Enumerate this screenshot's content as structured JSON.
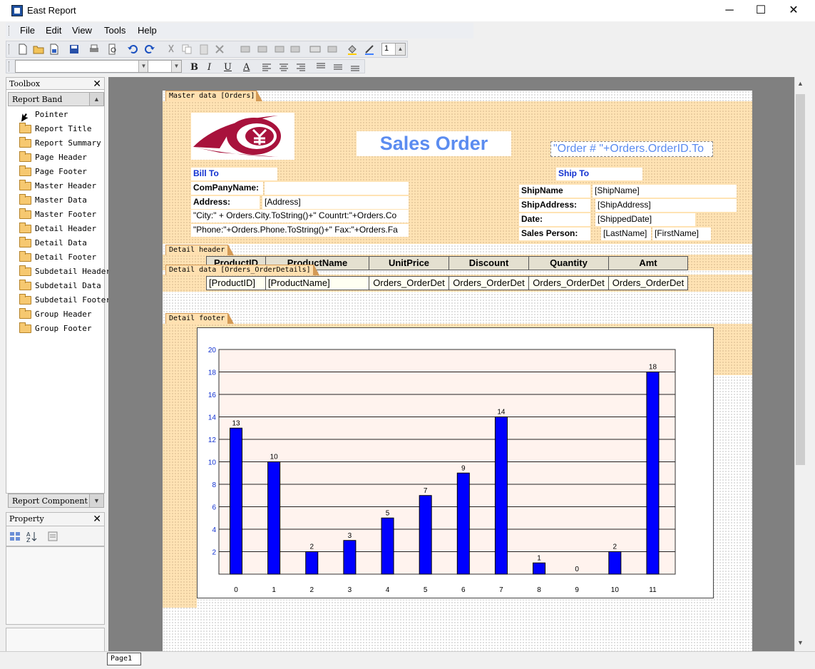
{
  "window": {
    "title": "East Report",
    "controls": [
      "─",
      "☐",
      "✕"
    ]
  },
  "menu": [
    "File",
    "Edit",
    "View",
    "Tools",
    "Help"
  ],
  "toolbar": {
    "spin_value": "1"
  },
  "format_toolbar": {
    "bold": "B",
    "italic": "I",
    "underline": "U",
    "font_color": "A"
  },
  "toolbox": {
    "title": "Toolbox",
    "band_header": "Report Band",
    "items": [
      "Pointer",
      "Report Title",
      "Report Summary",
      "Page Header",
      "Page Footer",
      "Master Header",
      "Master Data",
      "Master Footer",
      "Detail Header",
      "Detail Data",
      "Detail Footer",
      "Subdetail Header",
      "Subdetail Data",
      "Subdetail Footer",
      "Group Header",
      "Group Footer"
    ],
    "component_header": "Report Component"
  },
  "property": {
    "title": "Property"
  },
  "report": {
    "bands": {
      "master": "Master data [Orders]",
      "detail_header": "Detail header",
      "detail_data": "Detail data [Orders_OrderDetails]",
      "detail_footer": "Detail footer"
    },
    "title": "Sales Order",
    "order_expr": "\"Order # \"+Orders.OrderID.To",
    "bill_to": "Bill To",
    "ship_to": "Ship To",
    "company_label": "ComPanyName:",
    "address_label": "Address:",
    "address_value": "[Address]",
    "city_expr": "\"City:\"  +  Orders.City.ToString()+\"  Countrt:\"+Orders.Co",
    "phone_expr": "\"Phone:\"+Orders.Phone.ToString()+\" Fax:\"+Orders.Fa",
    "ship_name_label": "ShipName",
    "ship_name_value": "[ShipName]",
    "ship_address_label": "ShipAddress:",
    "ship_address_value": "[ShipAddress]",
    "date_label": "Date:",
    "date_value": "[ShippedDate]",
    "sales_person_label": "Sales Person:",
    "last_name": "[LastName]",
    "first_name": "[FirstName]",
    "table_headers": [
      "ProductID",
      "ProductName",
      "UnitPrice",
      "Discount",
      "Quantity",
      "Amt"
    ],
    "table_row": [
      "[ProductID]",
      "[ProductName]",
      "Orders_OrderDet",
      "Orders_OrderDet",
      "Orders_OrderDet",
      "Orders_OrderDet"
    ]
  },
  "colors": {
    "bar": "#0000ff",
    "band_bg": "#ffe3b4",
    "title_blue": "#5b8cf0",
    "logo": "#a8123c"
  },
  "chart_data": {
    "type": "bar",
    "categories": [
      "0",
      "1",
      "2",
      "3",
      "4",
      "5",
      "6",
      "7",
      "8",
      "9",
      "10",
      "11"
    ],
    "values": [
      13,
      10,
      2,
      3,
      5,
      7,
      9,
      14,
      1,
      0,
      2,
      18
    ],
    "ylim": [
      0,
      20
    ],
    "yticks": [
      "2",
      "4",
      "6",
      "8",
      "10",
      "12",
      "14",
      "16",
      "18",
      "20"
    ],
    "grid": true,
    "title": "",
    "xlabel": "",
    "ylabel": ""
  },
  "status": {
    "page_tab": "Page1"
  }
}
